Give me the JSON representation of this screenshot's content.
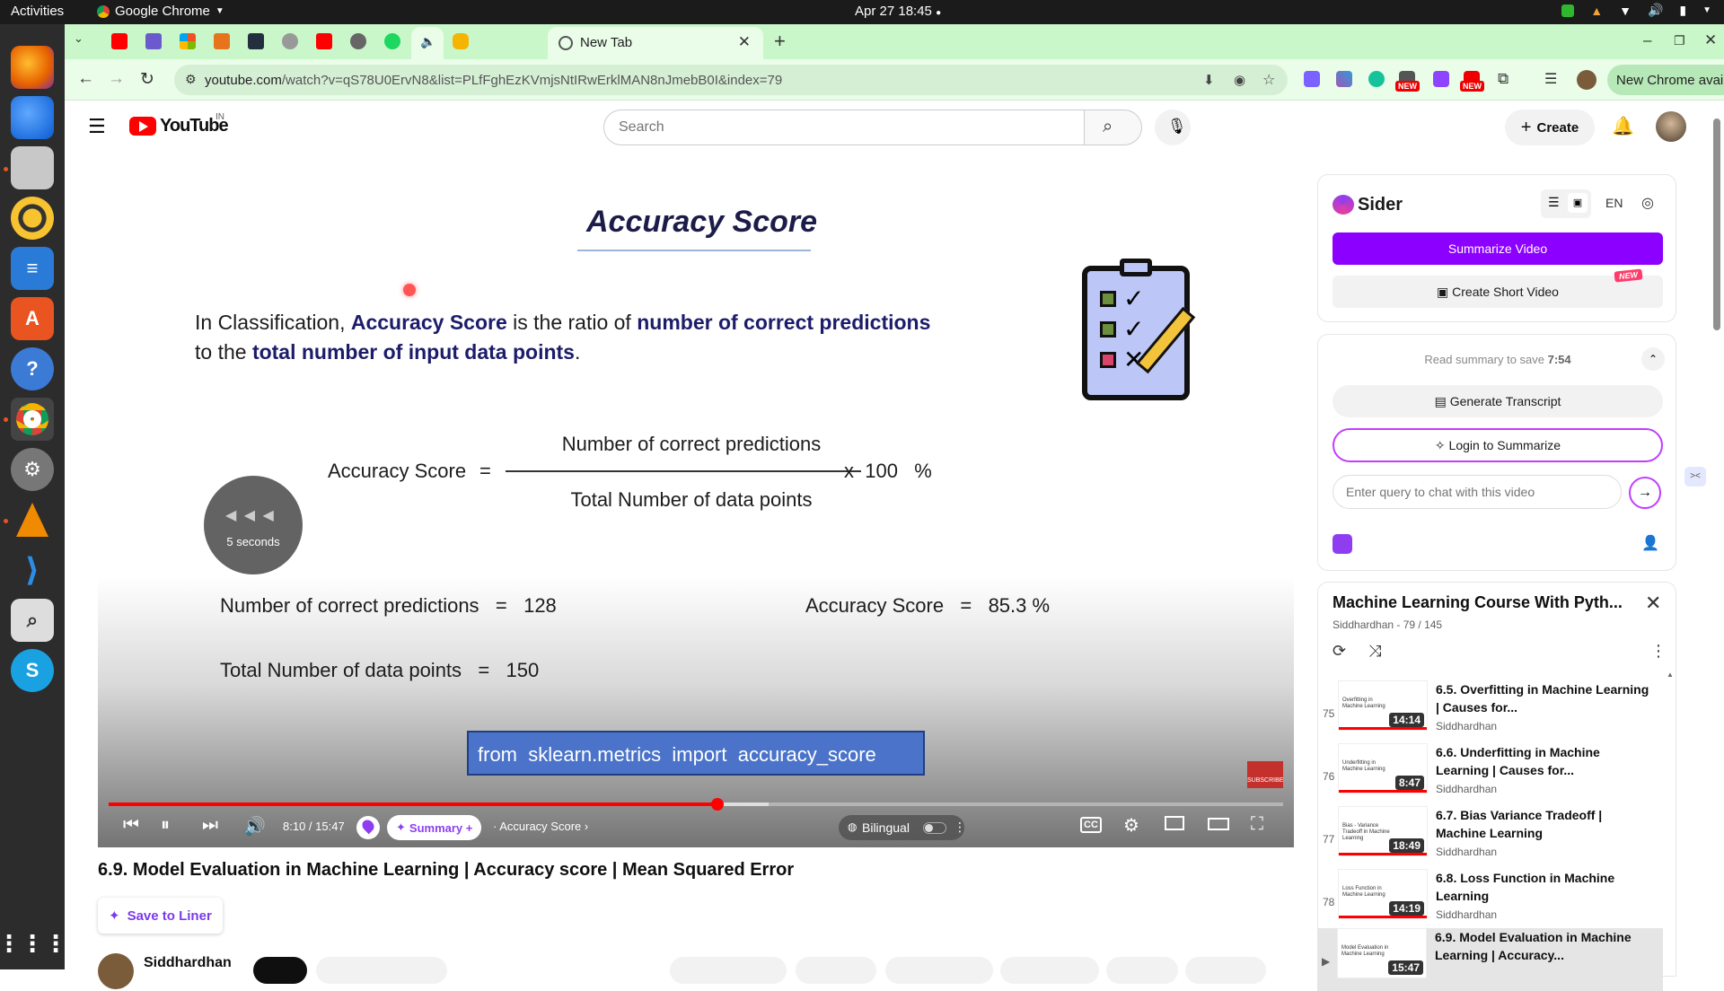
{
  "topbar": {
    "activities": "Activities",
    "app_name": "Google Chrome",
    "clock": "Apr 27  18:45"
  },
  "chrome": {
    "active_tab_title": "New Tab",
    "url_host": "youtube.com",
    "url_path": "/watch?v=qS78U0ErvN8&list=PLfFghEzKVmjsNtIRwErklMAN8nJmebB0I&index=79",
    "update_label": "New Chrome available",
    "new_badge": "NEW"
  },
  "youtube": {
    "logo_text": "YouTube",
    "country_code": "IN",
    "search_placeholder": "Search",
    "create_label": "Create"
  },
  "slide": {
    "title": "Accuracy Score",
    "intro_1_a": "In Classification, ",
    "intro_1_b": "Accuracy Score",
    "intro_1_c": " is the ratio of ",
    "intro_1_d": "number of correct predictions",
    "intro_2_a": "to the ",
    "intro_2_b": "total number of input data points",
    "intro_2_c": ".",
    "formula_lhs": "Accuracy Score",
    "formula_eq": "=",
    "formula_num": "Number of correct predictions",
    "formula_den": "Total Number of data points",
    "formula_mult": "x  100   %",
    "correct_label": "Number of correct predictions   =   128",
    "total_label": "Total Number of data points   =   150",
    "result_label": "Accuracy Score   =   85.3 %",
    "code": "from  sklearn.metrics  import  accuracy_score",
    "seek_label": "5 seconds",
    "subscribe": "SUBSCRIBE"
  },
  "player": {
    "time": "8:10 / 15:47",
    "progress_fraction": 0.518,
    "buffer_fraction": 0.562,
    "summary_label": "Summary +",
    "chapter_label": "· Accuracy Score",
    "bilingual_label": "Bilingual"
  },
  "video": {
    "title": "6.9. Model Evaluation in Machine Learning | Accuracy score | Mean Squared Error",
    "save_to_liner": "Save to Liner",
    "channel": "Siddhardhan"
  },
  "sider": {
    "brand": "Sider",
    "lang": "EN",
    "summarize_video": "Summarize Video",
    "create_short": "Create Short Video",
    "new_badge": "NEW",
    "read_summary": "Read summary to save ",
    "read_summary_time": "7:54",
    "generate_transcript": "Generate Transcript",
    "login_to_summarize": "Login to Summarize",
    "chat_placeholder": "Enter query to chat with this video"
  },
  "playlist": {
    "title": "Machine Learning Course With Pyth...",
    "subtitle": "Siddhardhan - 79 / 145",
    "items": [
      {
        "num": "75",
        "title": "6.5. Overfitting in Machine Learning | Causes for...",
        "channel": "Siddhardhan",
        "duration": "14:14",
        "thumb_title": "Overfitting in Machine Learning"
      },
      {
        "num": "76",
        "title": "6.6. Underfitting in Machine Learning | Causes for...",
        "channel": "Siddhardhan",
        "duration": "8:47",
        "thumb_title": "Underfitting in Machine Learning"
      },
      {
        "num": "77",
        "title": "6.7. Bias Variance Tradeoff | Machine Learning",
        "channel": "Siddhardhan",
        "duration": "18:49",
        "thumb_title": "Bias - Variance Tradeoff in Machine Learning"
      },
      {
        "num": "78",
        "title": "6.8. Loss Function in Machine Learning",
        "channel": "Siddhardhan",
        "duration": "14:19",
        "thumb_title": "Loss Function in Machine Learning"
      },
      {
        "num": "▶",
        "title": "6.9. Model Evaluation in Machine Learning | Accuracy...",
        "channel": "",
        "duration": "15:47",
        "thumb_title": "Model Evaluation in Machine Learning"
      }
    ]
  }
}
